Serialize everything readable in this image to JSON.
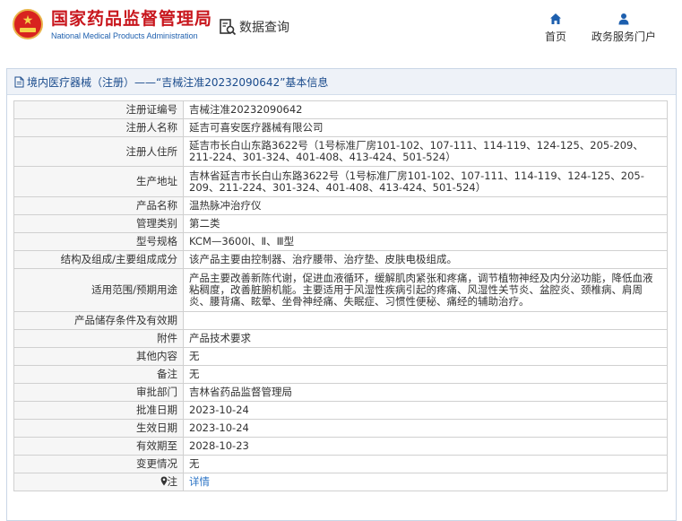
{
  "header": {
    "logo_cn": "国家药品监督管理局",
    "logo_en": "National Medical Products Administration",
    "query_label": "数据查询",
    "nav": [
      {
        "label": "首页",
        "icon": "home-icon"
      },
      {
        "label": "政务服务门户",
        "icon": "user-icon"
      }
    ],
    "accent_red": "#c8161d",
    "accent_blue": "#1d5fae"
  },
  "panel": {
    "title": "境内医疗器械（注册）——“吉械注准20232090642”基本信息"
  },
  "rows": [
    {
      "label": "注册证编号",
      "value": "吉械注准20232090642"
    },
    {
      "label": "注册人名称",
      "value": "延吉可喜安医疗器械有限公司"
    },
    {
      "label": "注册人住所",
      "value": "延吉市长白山东路3622号（1号标准厂房101-102、107-111、114-119、124-125、205-209、211-224、301-324、401-408、413-424、501-524）"
    },
    {
      "label": "生产地址",
      "value": "吉林省延吉市长白山东路3622号（1号标准厂房101-102、107-111、114-119、124-125、205-209、211-224、301-324、401-408、413-424、501-524）"
    },
    {
      "label": "产品名称",
      "value": "温热脉冲治疗仪"
    },
    {
      "label": "管理类别",
      "value": "第二类"
    },
    {
      "label": "型号规格",
      "value": "KCM—3600Ⅰ、Ⅱ、Ⅲ型"
    },
    {
      "label": "结构及组成/主要组成成分",
      "value": "该产品主要由控制器、治疗腰带、治疗垫、皮肤电极组成。"
    },
    {
      "label": "适用范围/预期用途",
      "value": "产品主要改善新陈代谢，促进血液循环，缓解肌肉紧张和疼痛，调节植物神经及内分泌功能，降低血液粘稠度，改善脏腑机能。主要适用于风湿性疾病引起的疼痛、风湿性关节炎、盆腔炎、颈椎病、肩周炎、腰背痛、眩晕、坐骨神经痛、失眠症、习惯性便秘、痛经的辅助治疗。"
    },
    {
      "label": "产品储存条件及有效期",
      "value": ""
    },
    {
      "label": "附件",
      "value": "产品技术要求"
    },
    {
      "label": "其他内容",
      "value": "无"
    },
    {
      "label": "备注",
      "value": "无"
    },
    {
      "label": "审批部门",
      "value": "吉林省药品监督管理局"
    },
    {
      "label": "批准日期",
      "value": "2023-10-24"
    },
    {
      "label": "生效日期",
      "value": "2023-10-24"
    },
    {
      "label": "有效期至",
      "value": "2028-10-23"
    },
    {
      "label": "变更情况",
      "value": "无"
    },
    {
      "label": "注",
      "value": "详情",
      "icon": "pin-icon"
    }
  ]
}
